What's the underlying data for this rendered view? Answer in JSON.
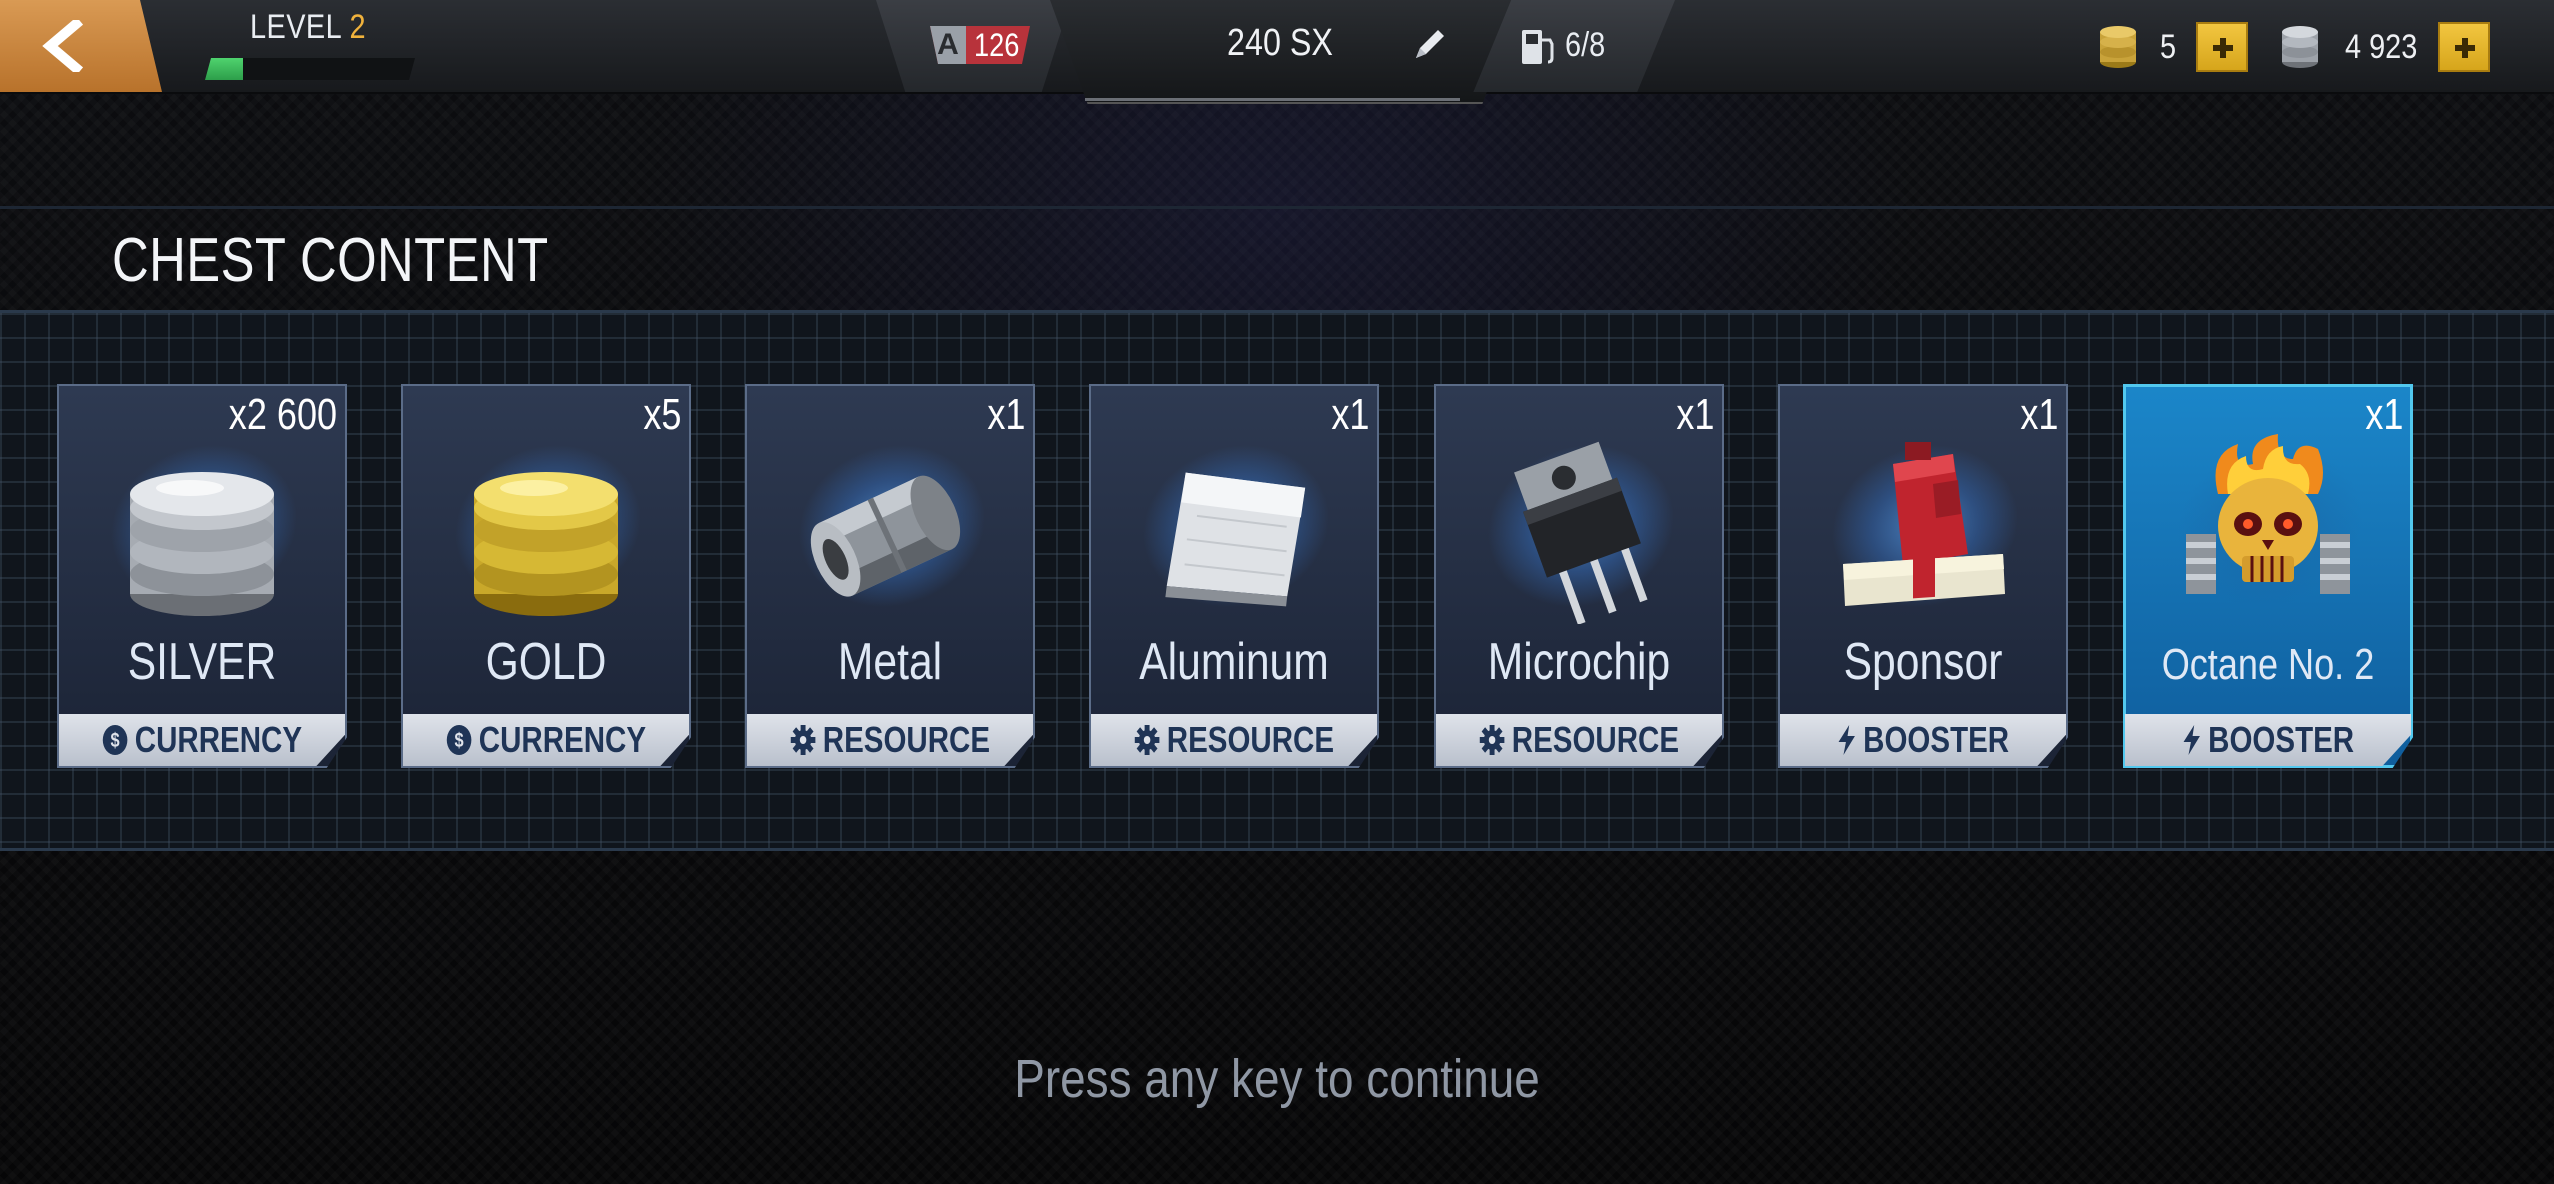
{
  "header": {
    "level_label": "LEVEL",
    "level_value": "2",
    "xp_progress": 0.18,
    "rating_class": "A",
    "rating_value": "126",
    "car_name": "240 SX",
    "fuel": "6/8",
    "gold_amount": "5",
    "silver_amount": "4 923",
    "icons": [
      "back-arrow-icon",
      "pencil-icon",
      "fuel-pump-icon",
      "gold-coins-icon",
      "silver-coins-icon",
      "plus-icon"
    ]
  },
  "section": {
    "title": "CHEST CONTENT"
  },
  "cards": [
    {
      "name": "SILVER",
      "qty": "x2 600",
      "type": "CURRENCY",
      "icon": "silver-coins"
    },
    {
      "name": "GOLD",
      "qty": "x5",
      "type": "CURRENCY",
      "icon": "gold-coins"
    },
    {
      "name": "Metal",
      "qty": "x1",
      "type": "RESOURCE",
      "icon": "metal-pipe"
    },
    {
      "name": "Aluminum",
      "qty": "x1",
      "type": "RESOURCE",
      "icon": "aluminum-sheet"
    },
    {
      "name": "Microchip",
      "qty": "x1",
      "type": "RESOURCE",
      "icon": "microchip"
    },
    {
      "name": "Sponsor",
      "qty": "x1",
      "type": "BOOSTER",
      "icon": "fuel-can-cash"
    },
    {
      "name": "Octane No. 2",
      "qty": "x1",
      "type": "BOOSTER",
      "icon": "flaming-skull",
      "highlighted": true
    }
  ],
  "footer": {
    "continue_text": "Press any key to continue"
  },
  "colors": {
    "accent_orange": "#c98438",
    "gold_button": "#e5b52a",
    "rating_red": "#b8333b",
    "xp_green": "#3fbf5f",
    "highlight_blue": "#1b86c9"
  }
}
